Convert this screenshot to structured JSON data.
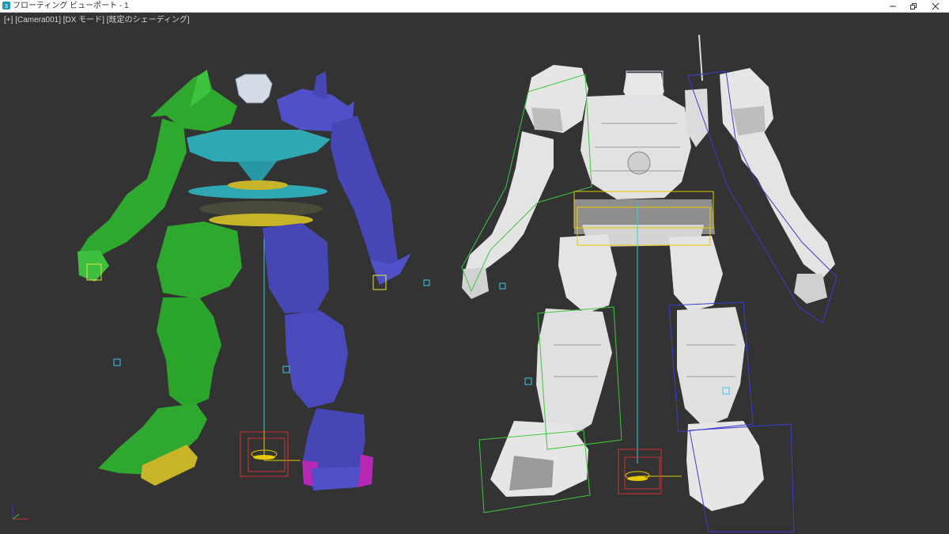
{
  "window": {
    "title": "フローティング ビューポート - 1"
  },
  "viewport": {
    "label_plus": "[+]",
    "label_camera": "[Camera001]",
    "label_mode": "[DX モード]",
    "label_shading": "[既定のシェーディング]"
  },
  "colors": {
    "background": "#333333",
    "left_arm_leg": "#2fa82f",
    "right_arm_leg": "#4646b4",
    "torso_disc": "#2fa8b4",
    "pelvis": "#c8b428",
    "foot_pad": "#b428b4",
    "mesh_white": "#e8e8e8",
    "bbox_green": "#3cc83c",
    "bbox_blue": "#3c3cd2",
    "bbox_yellow": "#e6c800",
    "root_red": "#d23232"
  },
  "icons": {
    "app": "3dsmax-icon",
    "minimize": "minimize-icon",
    "maximize": "restore-icon",
    "close": "close-icon"
  }
}
